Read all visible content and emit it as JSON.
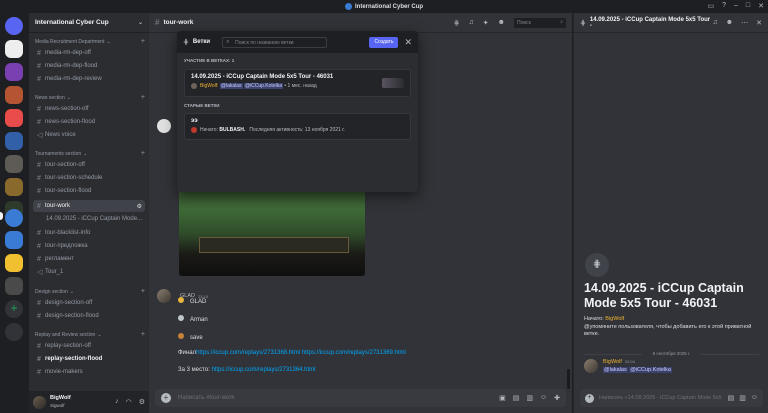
{
  "window": {
    "title": "International Cyber Cup"
  },
  "server": {
    "name": "International Cyber Cup",
    "categories": {
      "media": "Media Recruitment Department",
      "news": "News section",
      "tournaments": "Tournaments section",
      "design": "Design section",
      "replay": "Replay and Review section"
    },
    "channels": {
      "media_rm_dep_off": "media-rm-dep-off",
      "media_rm_dep_flood": "media-rm-dep-flood",
      "media_rm_dep_review": "media-rm-dep-review",
      "news_section_off": "news-section-off",
      "news_section_flood": "news-section-flood",
      "news_voice": "News voice",
      "tour_section_off": "tour-section-off",
      "tour_section_schedule": "tour-section-schedule",
      "tour_section_flood": "tour-section-flood",
      "tour_work": "tour-work",
      "tour_thread": "14.09.2025 - iCCup Captain Mode...",
      "tour_blacklist_info": "tour-blacklist-info",
      "tour_predlozhka": "tour-предложка",
      "reglament": "регламент",
      "tour_1": "Tour_1",
      "design_section_off": "design-section-off",
      "design_section_flood": "design-section-flood",
      "replay_section_off": "replay-section-off",
      "replay_section_flood": "replay-section-flood",
      "movie_makers": "movie-makers"
    }
  },
  "user": {
    "name": "BigWolf",
    "status": "Sigwolf"
  },
  "channel_header": {
    "name": "tour-work",
    "search_placeholder": "Поиск"
  },
  "threads_popup": {
    "title": "Ветки",
    "search_placeholder": "Поиск по названию ветки",
    "create_label": "Создать",
    "section_participating": "УЧАСТИЕ В ВЕТКАХ: 1",
    "section_old": "СТАРЫЕ ВЕТКИ",
    "thread1": {
      "title": "14.09.2025 - iCCup Captain Mode 5x5 Tour - 46031",
      "author": "BigWolf:",
      "mention1": "@lakalas",
      "mention2": "@iCCup.Kotelka",
      "time": "• 1 мес. назад"
    },
    "thread2": {
      "title": "ээ",
      "started_label": "Начато:",
      "starter": "BULBASH.",
      "activity": "Последняя активность: 13 ноября 2021 г."
    }
  },
  "messages": {
    "author": "GLAD",
    "time": "23:15",
    "line1": "GLAD",
    "line2": "Arman",
    "line3": "save",
    "final_prefix": "Финал",
    "final_link1": "https://iccup.com/replays/2731368.html",
    "final_link2": "https://iccup.com/replays/2731369.html",
    "third_prefix": "За 3 место:",
    "third_link": "https://iccup.com/replays/2731364.html"
  },
  "composer": {
    "placeholder": "Написать #tour-work"
  },
  "right_panel": {
    "header_title": "14.09.2025 - iCCup Captain Mode 5x5 Tour -",
    "title": "14.09.2025 - iCCup Captain Mode 5x5 Tour - 46031",
    "started_label": "Начато:",
    "starter": "BigWolf",
    "hint": "@упомяните пользователя, чтобы добавить его к этой приватной ветке.",
    "date_divider": "6 сентября 2025 г.",
    "msg_author": "BigWolf",
    "msg_time": "22:04",
    "mention1": "@lakalas",
    "mention2": "@iCCup.Kotelka",
    "composer_placeholder": "Написать «14.09.2025 - iCCup Captain Mode 5x5"
  },
  "colors": {
    "accent": "#5865f2",
    "link": "#00a8fc",
    "mention": "#f0b232"
  }
}
